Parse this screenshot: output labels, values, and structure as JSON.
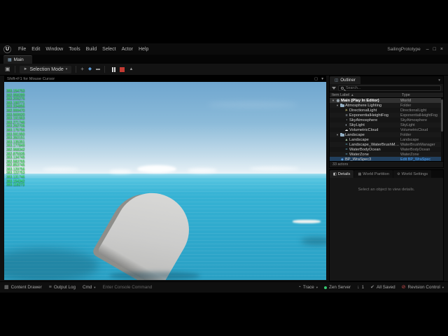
{
  "window": {
    "title": "SailingPrototype",
    "controls": [
      {
        "name": "minimize",
        "glyph": "–"
      },
      {
        "name": "maximize",
        "glyph": "□"
      },
      {
        "name": "close",
        "glyph": "×"
      }
    ]
  },
  "menu": {
    "items": [
      "File",
      "Edit",
      "Window",
      "Tools",
      "Build",
      "Select",
      "Actor",
      "Help"
    ]
  },
  "tabs": {
    "main": "Main"
  },
  "toolbar": {
    "mode_label": "Selection Mode"
  },
  "viewport": {
    "header": "Shift+F1 for Mouse Cursor",
    "debug_lines": [
      "383.154753",
      "382.958289",
      "383.209276",
      "383.190771",
      "383.334856",
      "382.999470",
      "383.569920",
      "383.191963",
      "383.271746",
      "383.292706",
      "383.175756",
      "383.591950",
      "383.350151",
      "383.135351",
      "383.177849",
      "382.968342",
      "382.875935",
      "383.134745",
      "382.583765",
      "382.853745",
      "383.129756",
      "383.122753",
      "383.131746",
      "383.154342",
      "383.118273"
    ]
  },
  "outliner": {
    "panel_title": "Outliner",
    "search_placeholder": "Search...",
    "columns": [
      "Item Label",
      "Type"
    ],
    "sort_indicator": "▲",
    "footer": "33 actors",
    "rows": [
      {
        "label": "Main (Play In Editor)",
        "type": "World",
        "icon": "world",
        "indent": 0,
        "expanded": true,
        "header": true
      },
      {
        "label": "Atmosphere Lighting",
        "type": "Folder",
        "icon": "folder",
        "indent": 1,
        "expanded": true
      },
      {
        "label": "DirectionalLight",
        "type": "DirectionalLight",
        "icon": "sun",
        "indent": 2
      },
      {
        "label": "ExponentialHeightFog",
        "type": "ExponentialHeightFog",
        "icon": "fog",
        "indent": 2
      },
      {
        "label": "SkyAtmosphere",
        "type": "SkyAtmosphere",
        "icon": "sky",
        "indent": 2
      },
      {
        "label": "SkyLight",
        "type": "SkyLight",
        "icon": "skylight",
        "indent": 2
      },
      {
        "label": "VolumetricCloud",
        "type": "VolumetricCloud",
        "icon": "cloud",
        "indent": 2
      },
      {
        "label": "Landscape",
        "type": "Folder",
        "icon": "folder",
        "indent": 1,
        "expanded": true
      },
      {
        "label": "Landscape",
        "type": "Landscape",
        "icon": "landscape",
        "indent": 2
      },
      {
        "label": "Landscape_WaterBrushManager",
        "type": "WaterBrushManager",
        "icon": "water",
        "indent": 2
      },
      {
        "label": "WaterBodyOcean",
        "type": "WaterBodyOcean",
        "icon": "water",
        "indent": 2
      },
      {
        "label": "WaterZone",
        "type": "WaterZone",
        "icon": "water",
        "indent": 2
      },
      {
        "label": "BP_WraSpec3",
        "type": "Edit BP_WraSpec",
        "icon": "blueprint",
        "indent": 1,
        "selected": true,
        "type_link": true
      }
    ]
  },
  "details": {
    "tabs": [
      "Details",
      "World Partition",
      "World Settings"
    ],
    "empty_text": "Select an object to view details."
  },
  "statusbar": {
    "content_drawer": "Content Drawer",
    "output_log": "Output Log",
    "cmd": "Cmd",
    "console_placeholder": "Enter Console Command",
    "trace": "Trace",
    "zen_server": "Zen Server",
    "badge_count": "1",
    "save_status": "All Saved",
    "revision_control": "Revision Control"
  },
  "icons": {
    "logo": "U",
    "level": "▦",
    "save": "▣",
    "cursor": "►",
    "dropdown": "▾",
    "quick_add": "+",
    "blueprint_tool": "◆",
    "cinematics": "▬",
    "eject": "▲",
    "maximize_vp": "▢",
    "outliner": "◫",
    "world": "◍",
    "sun": "☀",
    "fog": "≡",
    "sky": "◔",
    "skylight": "◐",
    "cloud": "☁",
    "landscape": "▲",
    "water": "≈",
    "blueprint": "◆",
    "content_drawer": "▦",
    "output_log": "≡",
    "trace": "◔",
    "download": "↓",
    "saved": "✔",
    "revision": "⊘",
    "details": "◧",
    "world_partition": "▦",
    "world_settings": "⚙"
  },
  "colors": {
    "accent_blue": "#4da6ff",
    "selection": "#22405e",
    "debug_green": "#2ee84a",
    "stop_red": "#c43b33",
    "zen_green": "#37c871",
    "revision_red": "#d05050",
    "sky_top": "#6fa6cf",
    "sea": "#2fa9cd",
    "boat_gray": "#cccccb"
  }
}
